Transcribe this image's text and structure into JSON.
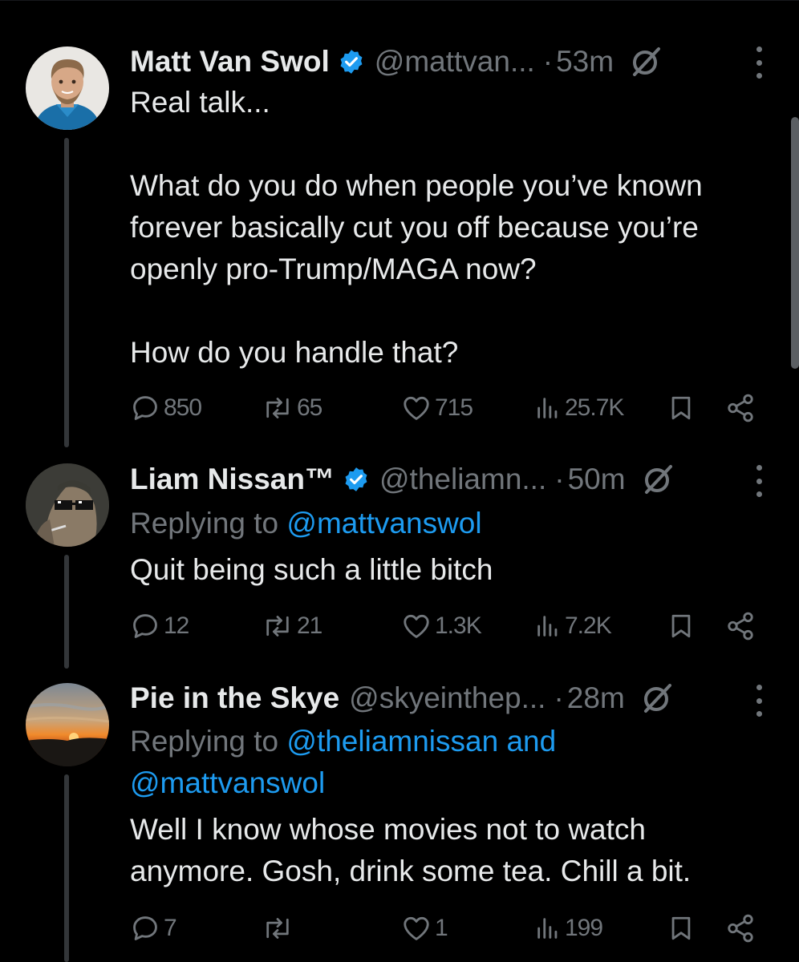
{
  "tweets": [
    {
      "name": "Matt Van Swol",
      "handle": "@mattvan...",
      "dot": "·",
      "time": "53m",
      "text": "Real talk...\n\nWhat do you do when people you’ve known forever basically cut you off because you’re openly pro-Trump/MAGA now?\n\nHow do you handle that?",
      "stats": {
        "replies": "850",
        "reposts": "65",
        "likes": "715",
        "views": "25.7K"
      }
    },
    {
      "name": "Liam Nissan™",
      "handle": "@theliamn...",
      "dot": "·",
      "time": "50m",
      "replying_prefix": "Replying to ",
      "replying_to": "@mattvanswol",
      "text": "Quit being such a little bitch",
      "stats": {
        "replies": "12",
        "reposts": "21",
        "likes": "1.3K",
        "views": "7.2K"
      }
    },
    {
      "name": "Pie in the Skye",
      "handle": "@skyeinthep...",
      "dot": "·",
      "time": "28m",
      "replying_prefix": "Replying to ",
      "replying_to_line1": "@theliamnissan and",
      "replying_to_line2": "@mattvanswol",
      "text": "Well I know whose movies not to watch anymore. Gosh, drink some tea. Chill a bit.",
      "stats": {
        "replies": "7",
        "reposts": "",
        "likes": "1",
        "views": "199"
      }
    }
  ],
  "colors": {
    "background": "#000000",
    "text": "#e7e9ea",
    "muted": "#71767b",
    "link": "#1d9bf0",
    "verified": "#1d9bf0"
  },
  "icons": [
    "verified-badge-icon",
    "grok-icon",
    "more-icon",
    "reply-icon",
    "repost-icon",
    "like-icon",
    "views-icon",
    "bookmark-icon",
    "share-icon"
  ]
}
